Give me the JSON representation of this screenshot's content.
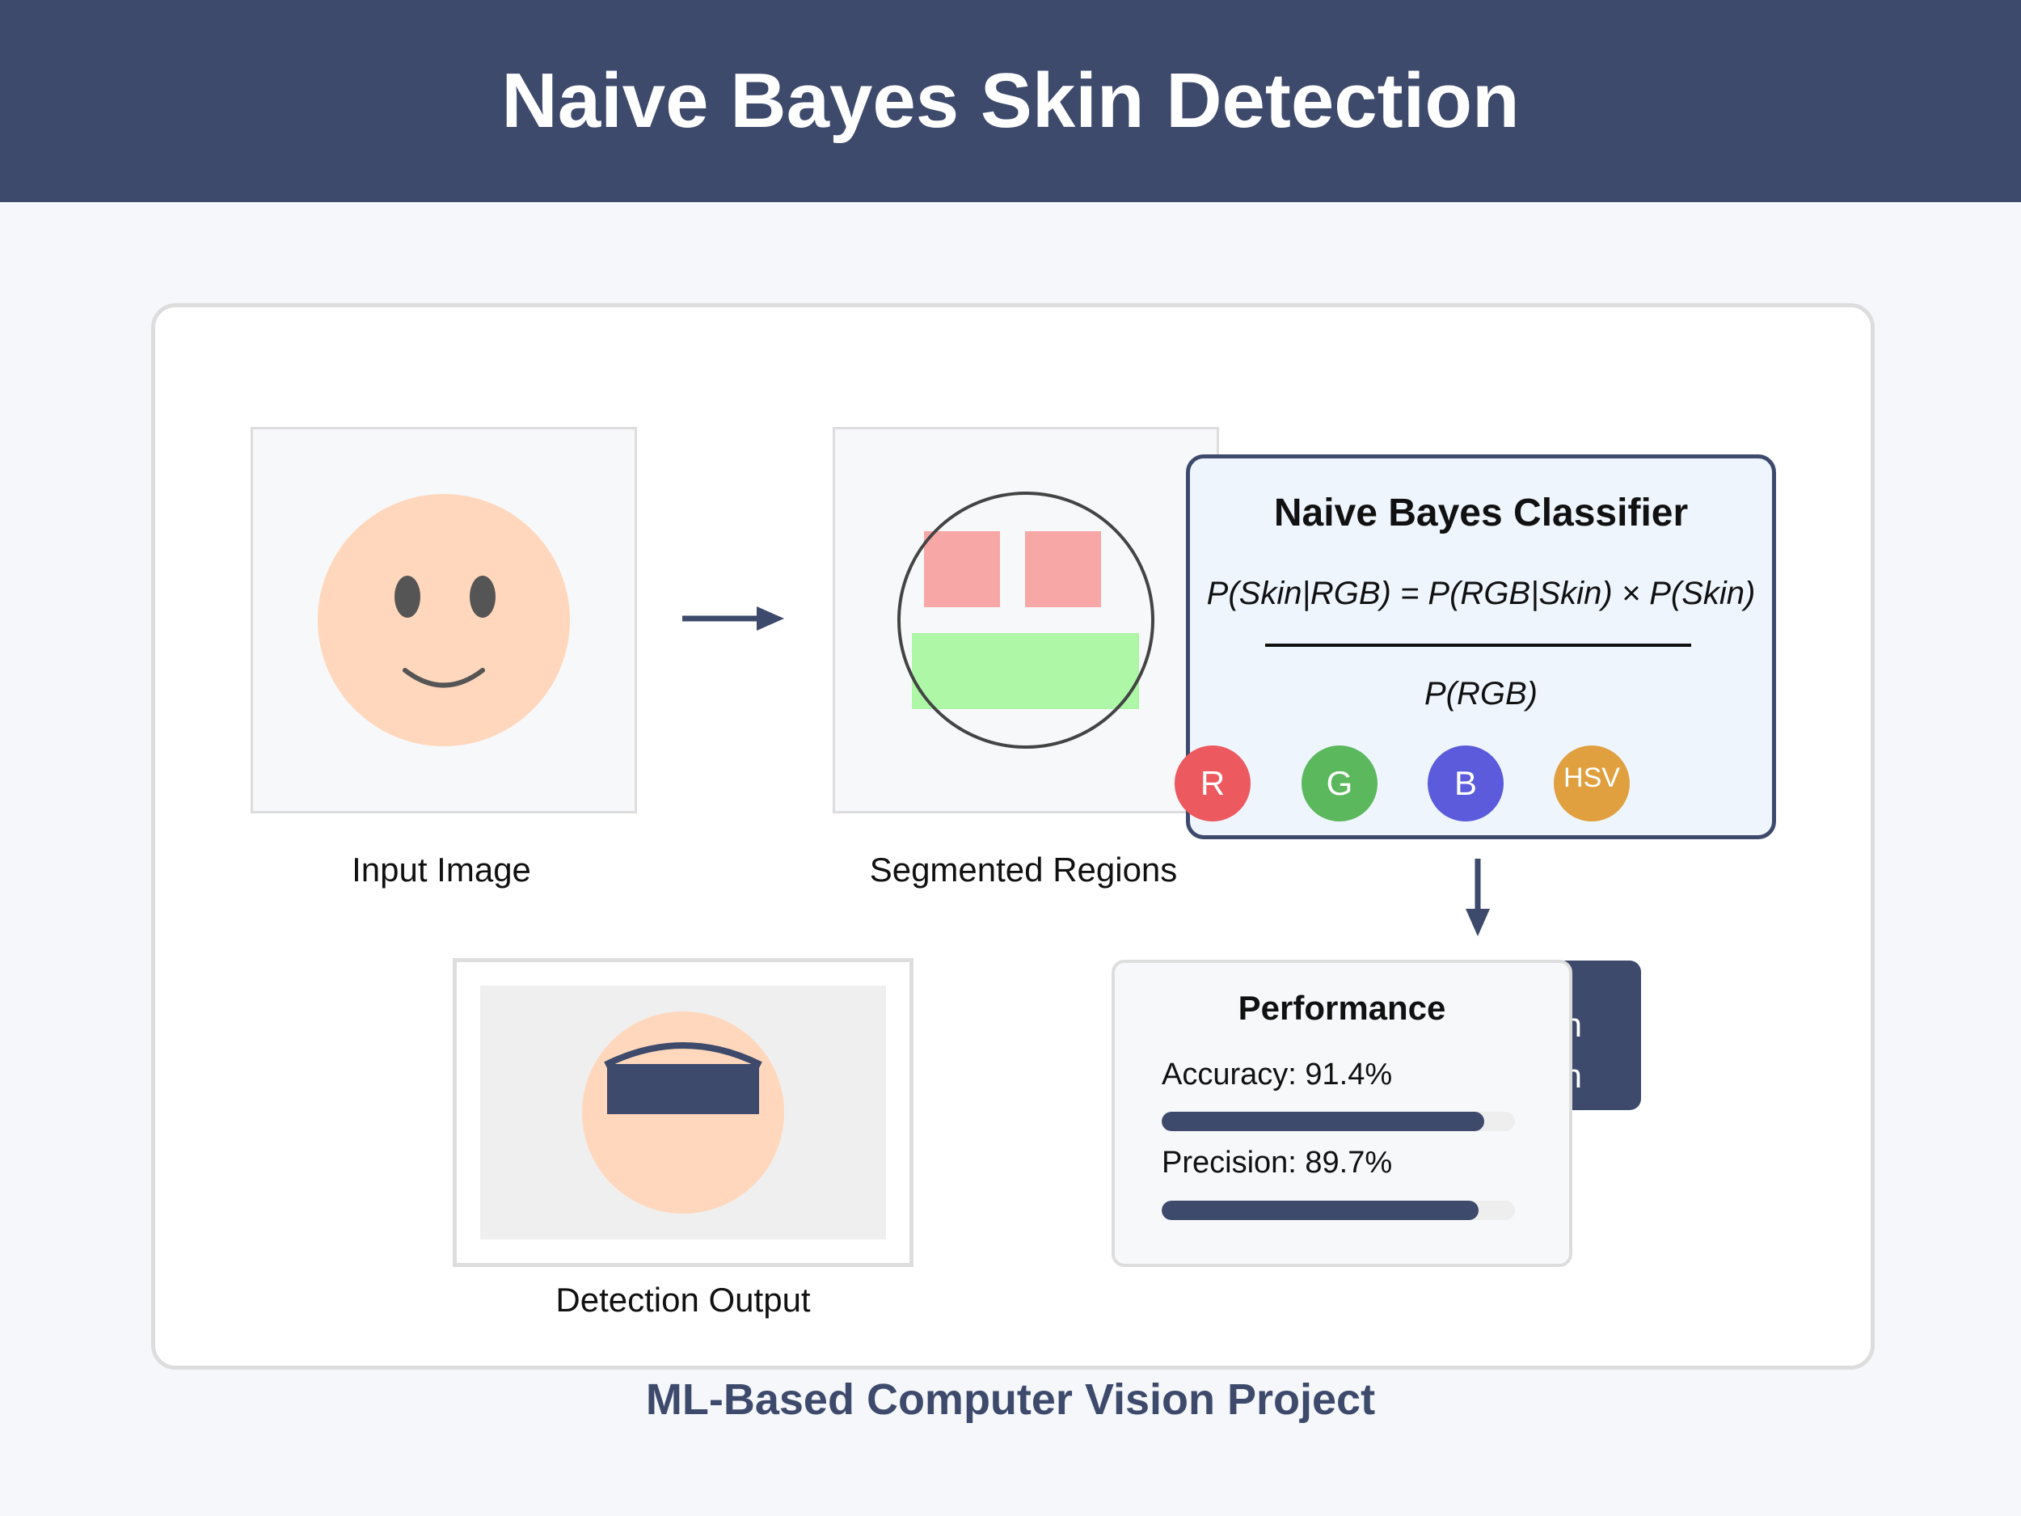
{
  "header": {
    "title": "Naive Bayes Skin Detection"
  },
  "colors": {
    "primary": "#3d4a6b",
    "skin": "#ffd7bc",
    "feature_r": "#ec5a5f",
    "feature_g": "#5cb85c",
    "feature_b": "#5b5bdc",
    "feature_hsv": "#e0a040",
    "region_red": "#f8a7a7",
    "region_green": "#adf7a7"
  },
  "panels": {
    "input": {
      "caption": "Input Image"
    },
    "segmented": {
      "caption": "Segmented Regions"
    },
    "output": {
      "caption": "Detection Output"
    }
  },
  "classifier": {
    "title": "Naive Bayes Classifier",
    "numerator": "P(Skin|RGB) = P(RGB|Skin) × P(Skin)",
    "denominator": "P(RGB)",
    "features": [
      "R",
      "G",
      "B",
      "HSV"
    ]
  },
  "dark_tab": {
    "line1": "n",
    "line2": "n"
  },
  "performance": {
    "title": "Performance",
    "metrics": [
      {
        "label": "Accuracy: 91.4%",
        "value": 0.914
      },
      {
        "label": "Precision: 89.7%",
        "value": 0.897
      }
    ]
  },
  "footer": {
    "text": "ML-Based Computer Vision Project"
  }
}
